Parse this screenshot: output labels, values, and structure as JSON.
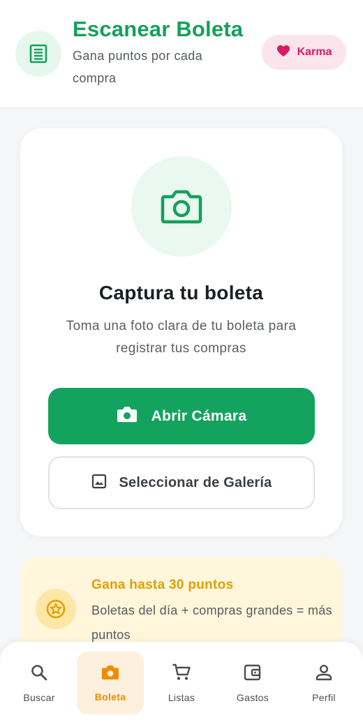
{
  "header": {
    "icon": "receipt-icon",
    "title": "Escanear Boleta",
    "subtitle": "Gana puntos por cada compra",
    "karma": {
      "icon": "heart-icon",
      "label": "Karma"
    }
  },
  "capture": {
    "icon": "camera-icon",
    "title": "Captura tu boleta",
    "description": "Toma una foto clara de tu boleta para registrar tus compras",
    "camera_button": {
      "icon": "camera-icon",
      "label": "Abrir Cámara"
    },
    "gallery_button": {
      "icon": "image-icon",
      "label": "Seleccionar de Galería"
    }
  },
  "points": {
    "icon": "star-coin-icon",
    "title": "Gana hasta 30 puntos",
    "description": "Boletas del día + compras grandes = más puntos"
  },
  "nav": {
    "items": [
      {
        "icon": "search-icon",
        "label": "Buscar",
        "active": false
      },
      {
        "icon": "camera-icon",
        "label": "Boleta",
        "active": true
      },
      {
        "icon": "cart-icon",
        "label": "Listas",
        "active": false
      },
      {
        "icon": "wallet-icon",
        "label": "Gastos",
        "active": false
      },
      {
        "icon": "person-icon",
        "label": "Perfil",
        "active": false
      }
    ]
  },
  "colors": {
    "brand_green": "#14a05a",
    "karma_pink": "#d81b60",
    "points_gold": "#e0a000",
    "nav_active": "#f08c00"
  }
}
